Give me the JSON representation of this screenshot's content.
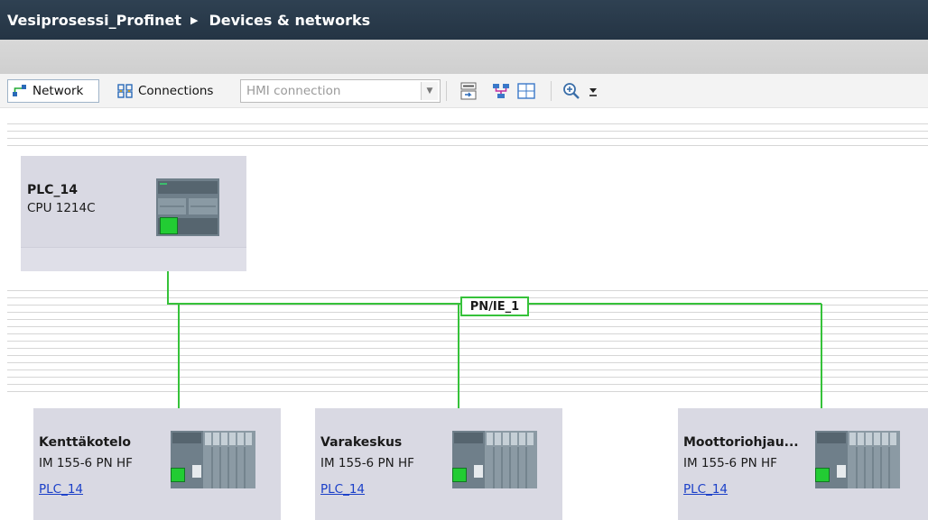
{
  "breadcrumb": {
    "project": "Vesiprosessi_Profinet",
    "view": "Devices & networks"
  },
  "toolbar": {
    "network_label": "Network",
    "connections_label": "Connections",
    "hmi_select_value": "HMI connection",
    "icons": [
      "network-icon",
      "connections-icon",
      "chevron-down-icon",
      "show-names-icon",
      "network-overview-icon",
      "grid-icon",
      "zoom-in-icon",
      "zoom-dropdown-icon"
    ]
  },
  "subnet": {
    "label": "PN/IE_1",
    "color": "#36c23a"
  },
  "devices": [
    {
      "name": "PLC_14",
      "type": "CPU 1214C",
      "link": ""
    },
    {
      "name": "Kenttäkotelo",
      "type": "IM 155-6 PN HF",
      "link": "PLC_14"
    },
    {
      "name": "Varakeskus",
      "type": "IM 155-6 PN HF",
      "link": "PLC_14"
    },
    {
      "name": "Moottoriohjau...",
      "type": "IM 155-6 PN HF",
      "link": "PLC_14"
    }
  ],
  "colors": {
    "titlebar": "#2f4152",
    "device_box": "#d9d9e3",
    "port_green": "#22cc33",
    "link_blue": "#1a3fc8"
  }
}
